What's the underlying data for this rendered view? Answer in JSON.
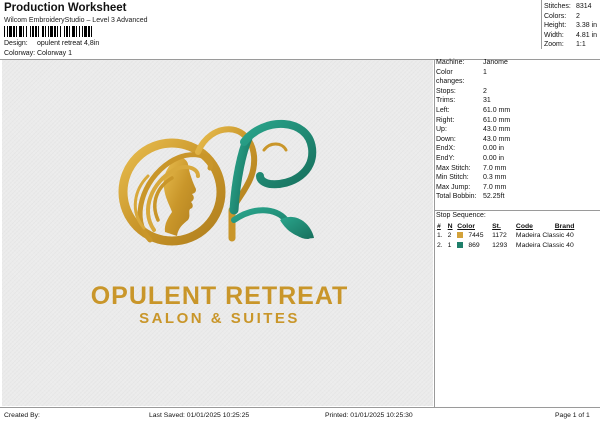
{
  "header": {
    "title": "Production Worksheet",
    "subtitle": "Wilcom EmbroideryStudio – Level 3 Advanced",
    "design_label": "Design:",
    "design_value": "opulent retreat 4,8in",
    "colorway_label": "Colorway:",
    "colorway_value": "Colorway 1"
  },
  "summary": [
    {
      "label": "Stitches:",
      "value": "8314"
    },
    {
      "label": "Colors:",
      "value": "2"
    },
    {
      "label": "Height:",
      "value": "3.38 in"
    },
    {
      "label": "Width:",
      "value": "4.81 in"
    },
    {
      "label": "Zoom:",
      "value": "1:1"
    }
  ],
  "stats": [
    {
      "label": "Machine:",
      "value": "Janome"
    },
    {
      "label": "Color changes:",
      "value": "1"
    },
    {
      "label": "Stops:",
      "value": "2"
    },
    {
      "label": "Trims:",
      "value": "31"
    },
    {
      "label": "Left:",
      "value": "61.0 mm"
    },
    {
      "label": "Right:",
      "value": "61.0 mm"
    },
    {
      "label": "Up:",
      "value": "43.0 mm"
    },
    {
      "label": "Down:",
      "value": "43.0 mm"
    },
    {
      "label": "EndX:",
      "value": "0.00 in"
    },
    {
      "label": "EndY:",
      "value": "0.00 in"
    },
    {
      "label": "Max Stitch:",
      "value": "7.0 mm"
    },
    {
      "label": "Min Stitch:",
      "value": "0.3 mm"
    },
    {
      "label": "Max Jump:",
      "value": "7.0 mm"
    },
    {
      "label": "Total Bobbin:",
      "value": "52.25ft"
    }
  ],
  "stop_sequence": {
    "title": "Stop Sequence:",
    "headers": {
      "#": "#",
      "n": "N",
      "color": "Color",
      "st": "St.",
      "code": "Code",
      "brand": "Brand"
    },
    "rows": [
      {
        "num": "1.",
        "n": "2",
        "color_hex": "#d3a23a",
        "color": "7445",
        "st": "1172",
        "code": "Madeira Classic 40",
        "brand": ""
      },
      {
        "num": "2.",
        "n": "1",
        "color_hex": "#1f7f6a",
        "color": "869",
        "st": "1293",
        "code": "Madeira Classic 40",
        "brand": ""
      }
    ]
  },
  "logo": {
    "name": "OPULENT RETREAT",
    "tagline": "SALON & SUITES",
    "gold": "#d0a032",
    "teal": "#1e8a74"
  },
  "footer": {
    "created_by": "Created By:",
    "last_saved": "Last Saved: 01/01/2025 10:25:25",
    "printed": "Printed: 01/01/2025 10:25:30",
    "page": "Page 1 of 1"
  }
}
